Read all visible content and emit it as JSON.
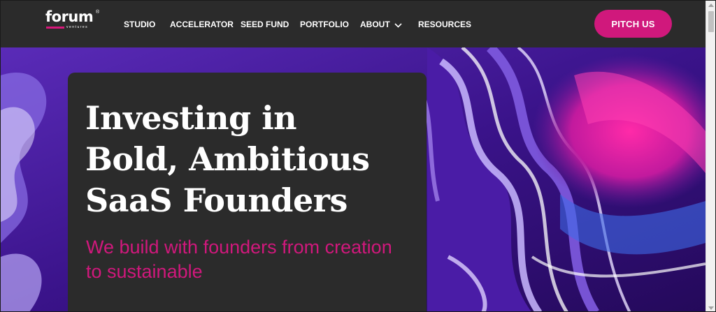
{
  "brand": {
    "name": "forum",
    "sub": "ventures",
    "reg": "®",
    "accent": "#d0187c"
  },
  "nav": {
    "items": [
      {
        "label": "STUDIO"
      },
      {
        "label": "ACCELERATOR"
      },
      {
        "label": "SEED FUND"
      },
      {
        "label": "PORTFOLIO"
      },
      {
        "label": "ABOUT",
        "dropdown": true,
        "icon": "chevron-down-icon"
      },
      {
        "label": "RESOURCES"
      }
    ],
    "cta_label": "PITCH US"
  },
  "hero": {
    "headline_line1": "Investing in",
    "headline_line2": "Bold, Ambitious",
    "headline_line3": "SaaS Founders",
    "subline_line1": "We build with founders from creation",
    "subline_line2": "to sustainable",
    "background": "purple-marble-image"
  }
}
